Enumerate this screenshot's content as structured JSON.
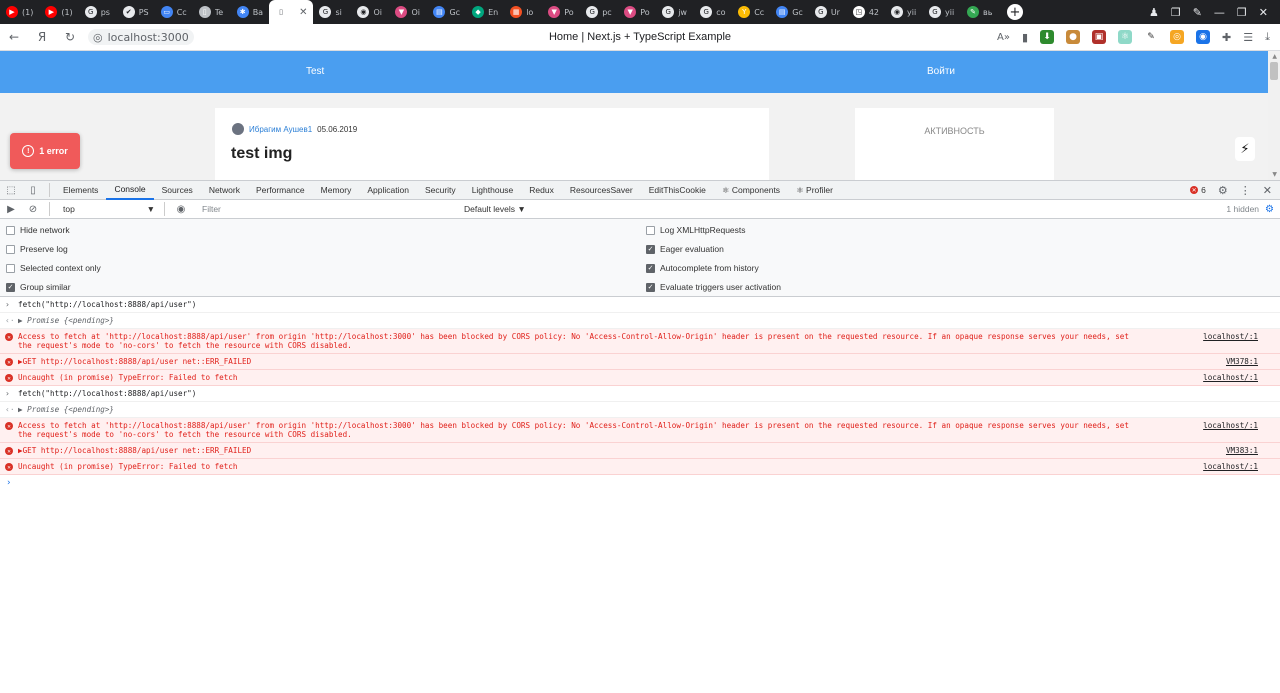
{
  "tabs": [
    {
      "label": "(1)",
      "color": "#ff0000",
      "glyph": "▶"
    },
    {
      "label": "(1)",
      "color": "#ff0000",
      "glyph": "▶"
    },
    {
      "label": "ps",
      "color": "#e8eaed",
      "glyph": "G"
    },
    {
      "label": "PS",
      "color": "#e8eaed",
      "glyph": "✔"
    },
    {
      "label": "Cc",
      "color": "#4285f4",
      "glyph": "▭"
    },
    {
      "label": "Te",
      "color": "#bdc1c6",
      "glyph": "▯"
    },
    {
      "label": "Ba",
      "color": "#4285f4",
      "glyph": "✱"
    },
    {
      "label": "",
      "color": "#5f6368",
      "glyph": "▯",
      "active": true
    },
    {
      "label": "si",
      "color": "#e8eaed",
      "glyph": "G"
    },
    {
      "label": "Oi",
      "color": "#e8eaed",
      "glyph": "◉"
    },
    {
      "label": "Oi",
      "color": "#db4b82",
      "glyph": "▼"
    },
    {
      "label": "Gc",
      "color": "#4285f4",
      "glyph": "▤"
    },
    {
      "label": "En",
      "color": "#00a67e",
      "glyph": "◆"
    },
    {
      "label": "lo",
      "color": "#f25022",
      "glyph": "▦"
    },
    {
      "label": "Po",
      "color": "#db4b82",
      "glyph": "▼"
    },
    {
      "label": "pc",
      "color": "#e8eaed",
      "glyph": "G"
    },
    {
      "label": "Po",
      "color": "#db4b82",
      "glyph": "▼"
    },
    {
      "label": "jw",
      "color": "#e8eaed",
      "glyph": "G"
    },
    {
      "label": "co",
      "color": "#e8eaed",
      "glyph": "G"
    },
    {
      "label": "Cc",
      "color": "#fbbc04",
      "glyph": "Y"
    },
    {
      "label": "Gc",
      "color": "#4285f4",
      "glyph": "▤"
    },
    {
      "label": "Ur",
      "color": "#e8eaed",
      "glyph": "G"
    },
    {
      "label": "42",
      "color": "#ffffff",
      "glyph": "◳"
    },
    {
      "label": "yii",
      "color": "#e8eaed",
      "glyph": "◉"
    },
    {
      "label": "yii",
      "color": "#e8eaed",
      "glyph": "G"
    },
    {
      "label": "вь",
      "color": "#34a853",
      "glyph": "✎"
    }
  ],
  "toolbar": {
    "address": "localhost:3000",
    "page_title": "Home | Next.js + TypeScript Example",
    "translate_label": "Я"
  },
  "site": {
    "nav_left": "Test",
    "nav_right": "Войти",
    "post_author": "Ибрагим Аушев1",
    "post_date": "05.06.2019",
    "post_title": "test img",
    "side_title": "АКТИВНОСТЬ",
    "error_pill": "1 error"
  },
  "devtools": {
    "tabs": [
      "Elements",
      "Console",
      "Sources",
      "Network",
      "Performance",
      "Memory",
      "Application",
      "Security",
      "Lighthouse",
      "Redux",
      "ResourcesSaver",
      "EditThisCookie",
      "⚛ Components",
      "⚛ Profiler"
    ],
    "active_tab": "Console",
    "error_count": "6",
    "context": "top",
    "filter_placeholder": "Filter",
    "levels": "Default levels ▼",
    "hidden": "1 hidden",
    "settings_left": [
      {
        "label": "Hide network",
        "checked": false
      },
      {
        "label": "Preserve log",
        "checked": false
      },
      {
        "label": "Selected context only",
        "checked": false
      },
      {
        "label": "Group similar",
        "checked": true
      }
    ],
    "settings_right": [
      {
        "label": "Log XMLHttpRequests",
        "checked": false
      },
      {
        "label": "Eager evaluation",
        "checked": true
      },
      {
        "label": "Autocomplete from history",
        "checked": true
      },
      {
        "label": "Evaluate triggers user activation",
        "checked": true
      }
    ]
  },
  "console": [
    {
      "kind": "input",
      "text": "fetch(\"http://localhost:8888/api/user\")"
    },
    {
      "kind": "result",
      "text": "▶ Promise {<pending>}"
    },
    {
      "kind": "error",
      "text": "Access to fetch at 'http://localhost:8888/api/user' from origin 'http://localhost:3000' has been blocked by CORS policy: No 'Access-Control-Allow-Origin' header is present on the requested resource. If an opaque response serves your needs, set\nthe request's mode to 'no-cors' to fetch the resource with CORS disabled.",
      "src": "localhost/:1"
    },
    {
      "kind": "error",
      "text": "▶GET http://localhost:8888/api/user net::ERR_FAILED",
      "src": "VM378:1"
    },
    {
      "kind": "error",
      "text": "Uncaught (in promise) TypeError: Failed to fetch",
      "src": "localhost/:1"
    },
    {
      "kind": "input",
      "text": "fetch(\"http://localhost:8888/api/user\")"
    },
    {
      "kind": "result",
      "text": "▶ Promise {<pending>}"
    },
    {
      "kind": "error",
      "text": "Access to fetch at 'http://localhost:8888/api/user' from origin 'http://localhost:3000' has been blocked by CORS policy: No 'Access-Control-Allow-Origin' header is present on the requested resource. If an opaque response serves your needs, set\nthe request's mode to 'no-cors' to fetch the resource with CORS disabled.",
      "src": "localhost/:1"
    },
    {
      "kind": "error",
      "text": "▶GET http://localhost:8888/api/user net::ERR_FAILED",
      "src": "VM383:1"
    },
    {
      "kind": "error",
      "text": "Uncaught (in promise) TypeError: Failed to fetch",
      "src": "localhost/:1"
    }
  ]
}
